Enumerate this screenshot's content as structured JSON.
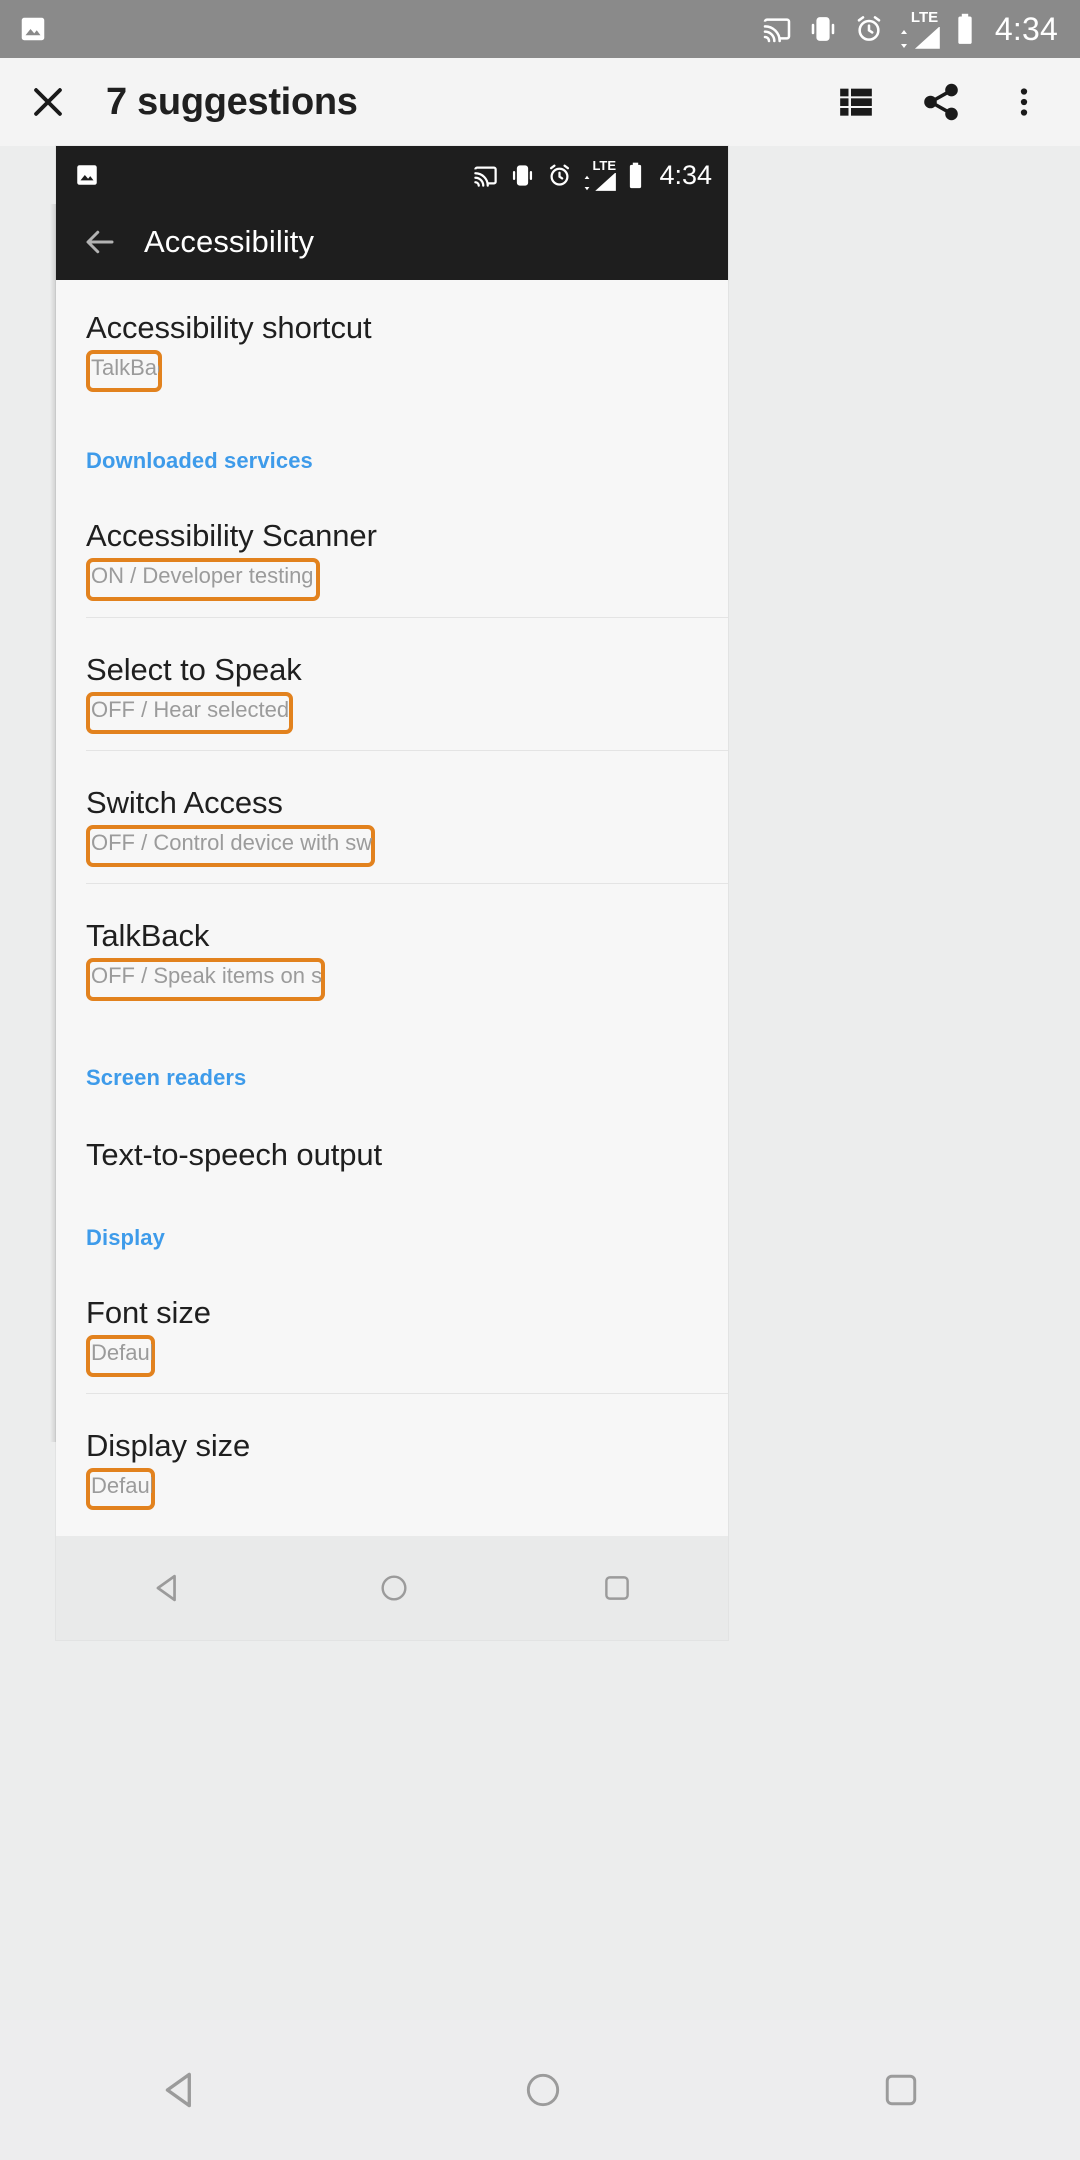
{
  "outer_status_bar": {
    "left_icons": [
      "image-icon"
    ],
    "right_icons": [
      "cast-icon",
      "vibrate-icon",
      "alarm-icon",
      "lte-icon",
      "signal-icon",
      "battery-icon"
    ],
    "lte_label": "LTE",
    "time": "4:34"
  },
  "outer_app_bar": {
    "close_label": "close-icon",
    "title": "7 suggestions",
    "actions": [
      "list-view-icon",
      "share-icon",
      "overflow-menu-icon"
    ]
  },
  "screenshot": {
    "status_bar": {
      "left_icons": [
        "image-icon"
      ],
      "right_icons": [
        "cast-icon",
        "vibrate-icon",
        "alarm-icon",
        "lte-icon",
        "signal-icon",
        "battery-icon"
      ],
      "lte_label": "LTE",
      "time": "4:34"
    },
    "app_bar": {
      "back_label": "back-arrow-icon",
      "title": "Accessibility"
    },
    "items": [
      {
        "type": "item",
        "title": "Accessibility shortcut",
        "subtitle": "TalkBack",
        "highlighted": true,
        "clip_width": 68
      },
      {
        "type": "section",
        "title": "Downloaded services"
      },
      {
        "type": "item",
        "title": "Accessibility Scanner",
        "subtitle": "ON / Developer testing tool",
        "highlighted": true,
        "clip_width": 226
      },
      {
        "type": "divider"
      },
      {
        "type": "item",
        "title": "Select to Speak",
        "subtitle": "OFF / Hear selected text",
        "highlighted": true,
        "clip_width": 199
      },
      {
        "type": "divider"
      },
      {
        "type": "item",
        "title": "Switch Access",
        "subtitle": "OFF / Control device with switches",
        "highlighted": true,
        "clip_width": 281
      },
      {
        "type": "divider"
      },
      {
        "type": "item",
        "title": "TalkBack",
        "subtitle": "OFF / Speak items on screen",
        "highlighted": true,
        "clip_width": 231
      },
      {
        "type": "section",
        "title": "Screen readers"
      },
      {
        "type": "item",
        "title": "Text-to-speech output",
        "subtitle": "",
        "highlighted": false,
        "clip_width": 0
      },
      {
        "type": "section",
        "title": "Display"
      },
      {
        "type": "item",
        "title": "Font size",
        "subtitle": "Default",
        "highlighted": true,
        "clip_width": 61
      },
      {
        "type": "divider"
      },
      {
        "type": "item",
        "title": "Display size",
        "subtitle": "Default",
        "highlighted": true,
        "clip_width": 61
      }
    ],
    "nav_bar": {
      "buttons": [
        "back-nav-icon",
        "home-nav-icon",
        "recents-nav-icon"
      ]
    }
  },
  "outer_nav_bar": {
    "buttons": [
      "back-nav-icon",
      "home-nav-icon",
      "recents-nav-icon"
    ]
  },
  "colors": {
    "highlight": "#e2821e",
    "section_header": "#3e9bea",
    "status_bar_outer": "#8a8a8a",
    "app_bar_outer": "#f4f4f4",
    "status_bar_inner": "#1e1e1e",
    "page_background": "#eceded"
  }
}
